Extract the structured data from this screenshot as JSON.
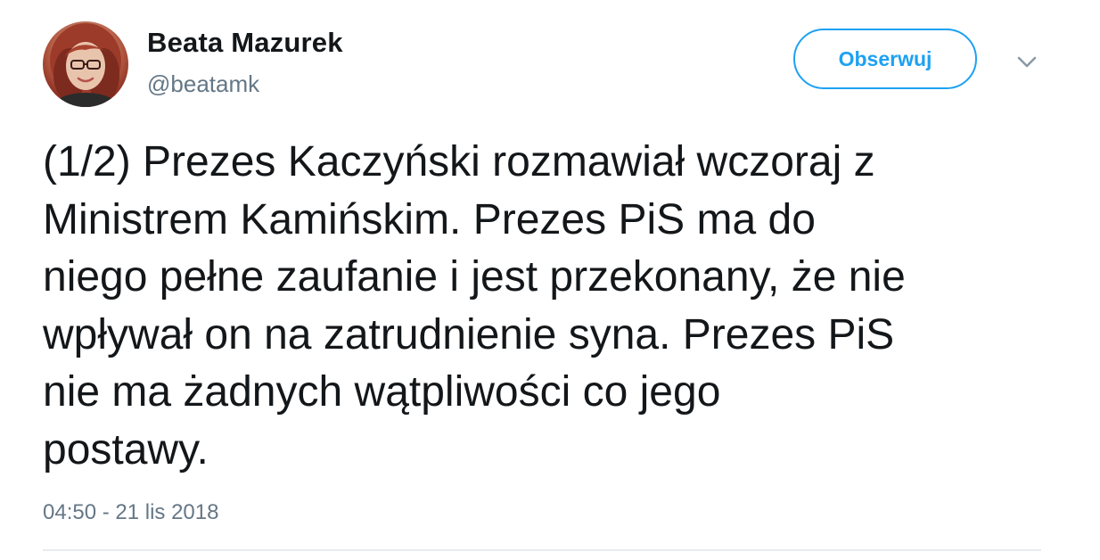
{
  "author": {
    "display_name": "Beata Mazurek",
    "handle": "@beatamk",
    "avatar_icon": "profile-photo"
  },
  "actions": {
    "follow_label": "Obserwuj",
    "more_icon": "chevron-down-icon"
  },
  "tweet": {
    "text": "(1/2) Prezes Kaczyński rozmawiał wczoraj z\nMinistrem Kamińskim. Prezes PiS ma do\nniego pełne zaufanie i jest przekonany, że nie\nwpływał on na zatrudnienie syna. Prezes PiS\nnie ma żadnych wątpliwości co jego\npostawy.",
    "timestamp": "04:50 - 21 lis 2018"
  },
  "colors": {
    "accent": "#1da1f2",
    "text_primary": "#14171a",
    "text_secondary": "#657786",
    "divider": "#e6ecf0"
  }
}
